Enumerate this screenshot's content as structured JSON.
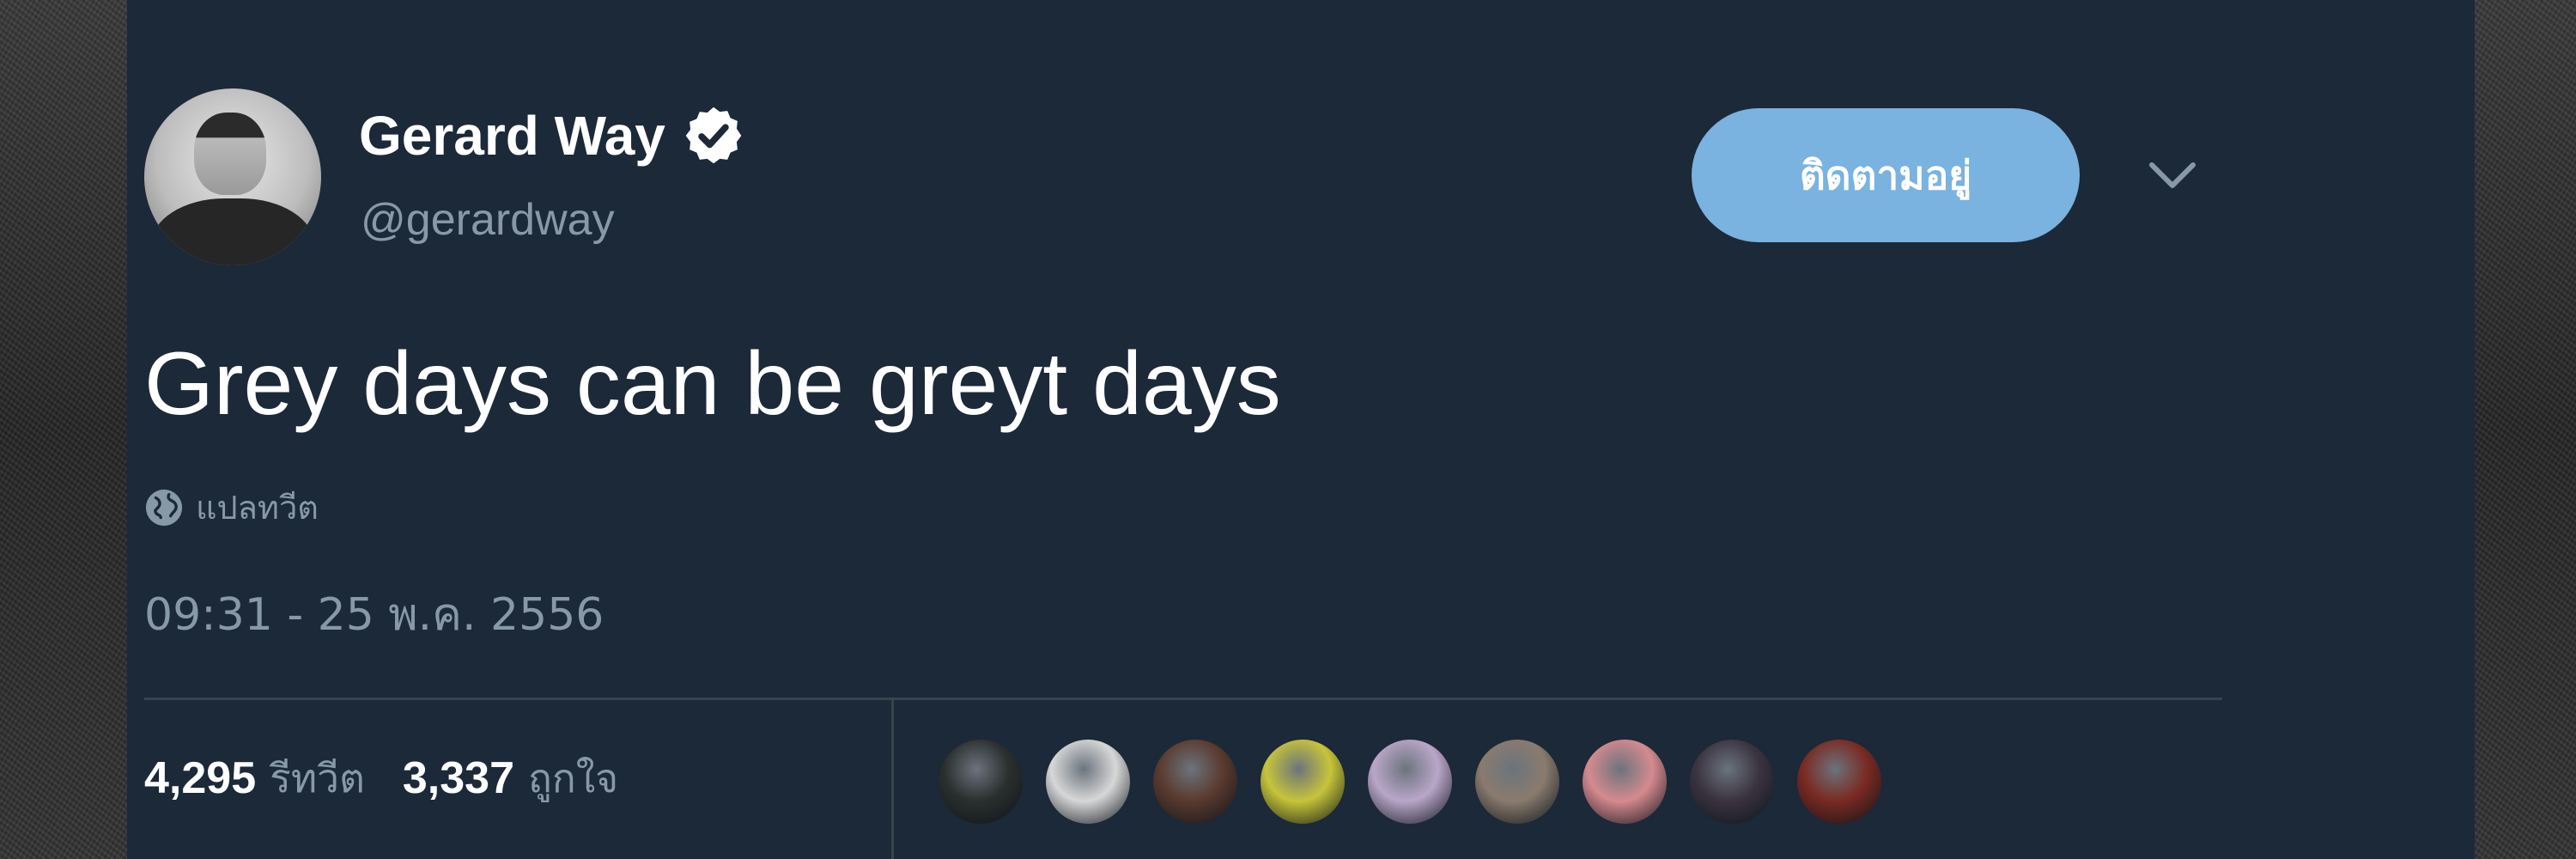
{
  "tweet": {
    "author": {
      "display_name": "Gerard Way",
      "handle": "@gerardway",
      "verified": true,
      "avatar_icon": "profile-photo"
    },
    "follow_button_label": "ติดตามอยู่",
    "text": "Grey days can be greyt days",
    "translate_label": "แปลทวีต",
    "timestamp": "09:31 - 25 พ.ค. 2556",
    "stats": {
      "retweets": "4,295",
      "retweets_label": "รีทวีต",
      "likes": "3,337",
      "likes_label": "ถูกใจ"
    },
    "likers": [
      {
        "icon": "liker-avatar-1",
        "color": "#2b2f2e"
      },
      {
        "icon": "liker-avatar-2",
        "color": "#d7d7d7"
      },
      {
        "icon": "liker-avatar-3",
        "color": "#5a3a2e"
      },
      {
        "icon": "liker-avatar-4",
        "color": "#c7c43a"
      },
      {
        "icon": "liker-avatar-5",
        "color": "#b9a6c8"
      },
      {
        "icon": "liker-avatar-6",
        "color": "#8a7b6e"
      },
      {
        "icon": "liker-avatar-7",
        "color": "#d58a8f"
      },
      {
        "icon": "liker-avatar-8",
        "color": "#3a3340"
      },
      {
        "icon": "liker-avatar-9",
        "color": "#7a2a22"
      }
    ]
  },
  "colors": {
    "card_background": "#1c2938",
    "follow_button": "#7ab2e0",
    "secondary_text": "#8899a6",
    "divider": "#38444d"
  }
}
